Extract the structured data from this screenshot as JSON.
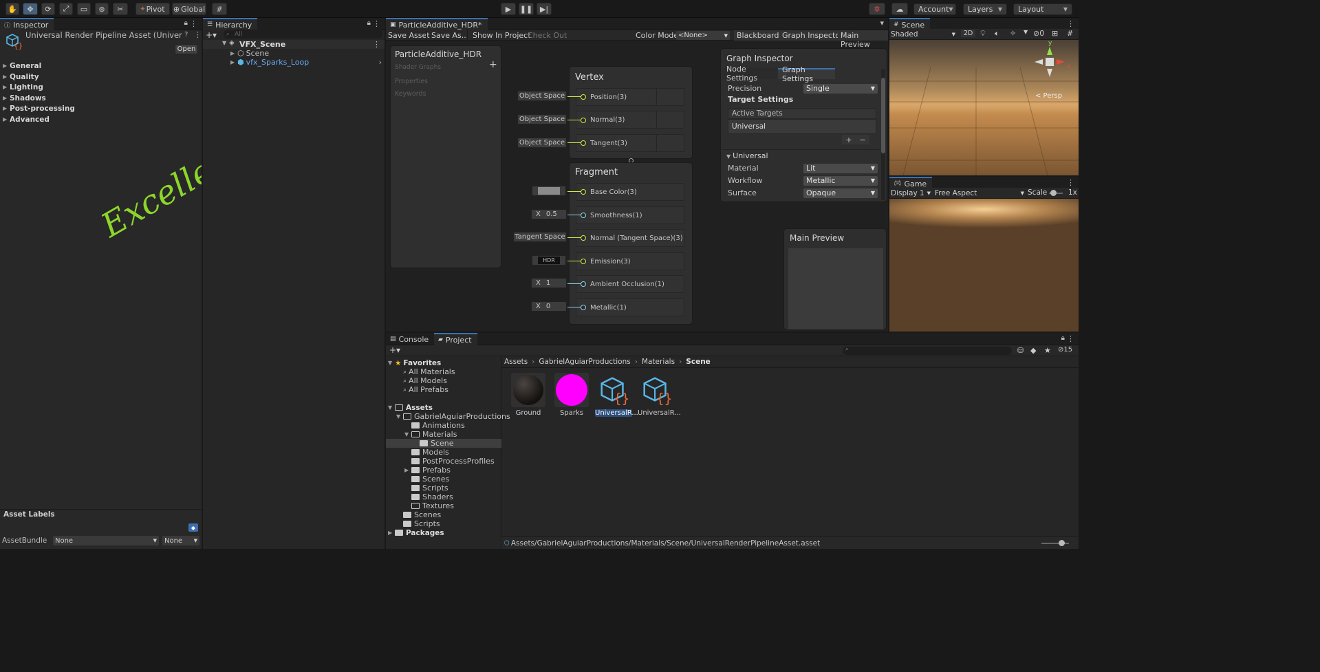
{
  "toolbar": {
    "tools": [
      "hand-tool",
      "move-tool",
      "rotate-tool",
      "scale-tool",
      "rect-tool",
      "transform-tool",
      "custom-tool"
    ],
    "pivot": "Pivot",
    "global": "Global",
    "account": "Account",
    "layers": "Layers",
    "layout": "Layout"
  },
  "inspector": {
    "tab": "Inspector",
    "asset_title": "Universal Render Pipeline Asset (Universal R",
    "open_button": "Open",
    "sections": [
      "General",
      "Quality",
      "Lighting",
      "Shadows",
      "Post-processing",
      "Advanced"
    ],
    "asset_labels": "Asset Labels",
    "assetbundle_label": "AssetBundle",
    "assetbundle_value": "None",
    "variant_value": "None",
    "handwriting": "Excellent Work"
  },
  "hierarchy": {
    "tab": "Hierarchy",
    "search_placeholder": "All",
    "scene": "VFX_Scene",
    "items": [
      "Scene",
      "vfx_Sparks_Loop"
    ]
  },
  "shadergraph": {
    "tab": "ParticleAdditive_HDR*",
    "toolbar": {
      "save": "Save Asset",
      "save_as": "Save As...",
      "show_in_project": "Show In Project",
      "check_out": "Check Out",
      "color_mode_label": "Color Mode",
      "color_mode_value": "<None>",
      "blackboard": "Blackboard",
      "graph_inspector": "Graph Inspector",
      "main_preview": "Main Preview"
    },
    "blackboard": {
      "title": "ParticleAdditive_HDR",
      "subtitle": "Shader Graphs",
      "properties": "Properties",
      "keywords": "Keywords"
    },
    "vertex": {
      "title": "Vertex",
      "slots": [
        "Position(3)",
        "Normal(3)",
        "Tangent(3)"
      ],
      "inputs": [
        "Object Space",
        "Object Space",
        "Object Space"
      ]
    },
    "fragment": {
      "title": "Fragment",
      "slots": [
        "Base Color(3)",
        "Smoothness(1)",
        "Normal (Tangent Space)(3)",
        "Emission(3)",
        "Ambient Occlusion(1)",
        "Metallic(1)"
      ],
      "smoothness": "0.5",
      "normal_space": "Tangent Space",
      "emission": "HDR",
      "ao": "1",
      "metallic": "0",
      "x": "X"
    },
    "inspector": {
      "title": "Graph Inspector",
      "tab_node": "Node Settings",
      "tab_graph": "Graph Settings",
      "precision_label": "Precision",
      "precision_value": "Single",
      "target_settings": "Target Settings",
      "active_targets": "Active Targets",
      "target_item": "Universal",
      "universal": "Universal",
      "material_label": "Material",
      "material_value": "Lit",
      "workflow_label": "Workflow",
      "workflow_value": "Metallic",
      "surface_label": "Surface",
      "surface_value": "Opaque"
    },
    "main_preview": "Main Preview"
  },
  "scene_view": {
    "tab": "Scene",
    "shading": "Shaded",
    "mode_2d": "2D",
    "hidden_count": "0",
    "persp": "< Persp",
    "gizmo_y": "y",
    "gizmo_x": "x"
  },
  "game_view": {
    "tab": "Game",
    "display": "Display 1",
    "aspect": "Free Aspect",
    "scale_label": "Scale",
    "scale_value": "1x"
  },
  "bottom": {
    "tab_console": "Console",
    "tab_project": "Project",
    "favorites": "Favorites",
    "fav_items": [
      "All Materials",
      "All Models",
      "All Prefabs"
    ],
    "assets": "Assets",
    "tree": [
      "GabrielAguiarProductions",
      "Animations",
      "Materials",
      "Scene",
      "Models",
      "PostProcessProfiles",
      "Prefabs",
      "Scenes",
      "Scripts",
      "Shaders",
      "Textures",
      "Scenes",
      "Scripts",
      "Packages"
    ],
    "breadcrumb": [
      "Assets",
      "GabrielAguiarProductions",
      "Materials",
      "Scene"
    ],
    "files": [
      "Ground",
      "Sparks",
      "UniversalR...",
      "UniversalR..."
    ],
    "hidden_count": "15",
    "status_path": "Assets/GabrielAguiarProductions/Materials/Scene/UniversalRenderPipelineAsset.asset"
  }
}
